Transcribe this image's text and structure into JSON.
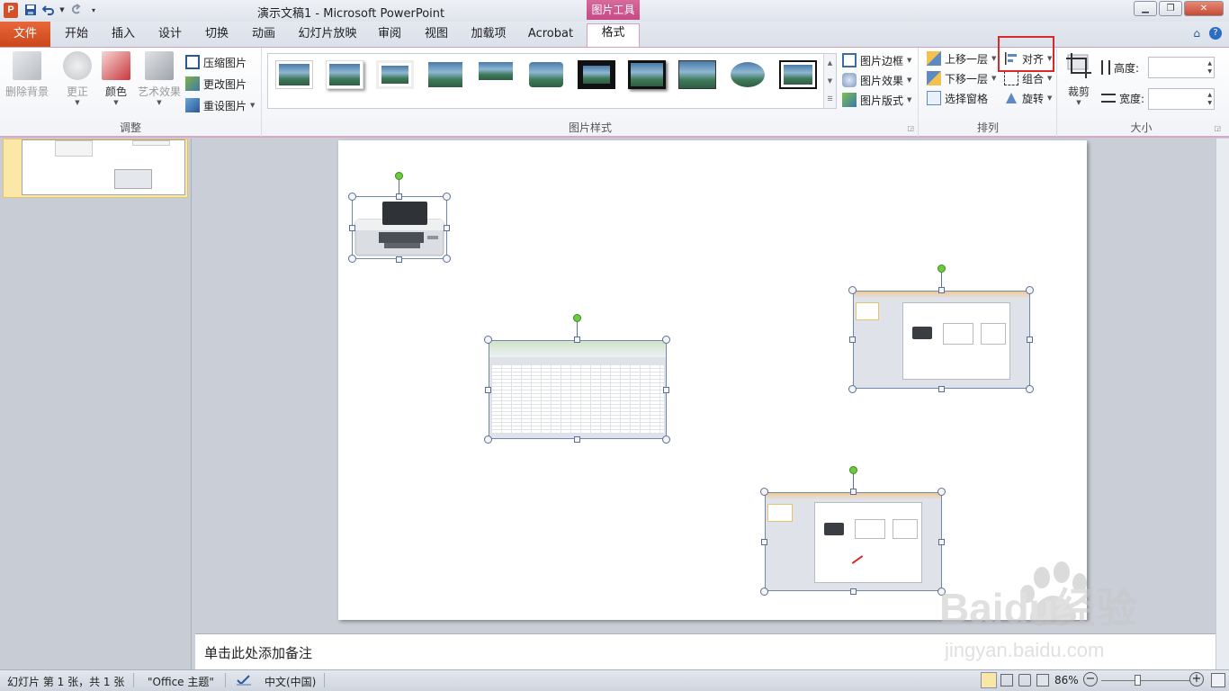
{
  "window": {
    "app_icon": "P",
    "title": "演示文稿1  -  Microsoft PowerPoint",
    "contextual_tab_header": "图片工具"
  },
  "tabs": [
    "文件",
    "开始",
    "插入",
    "设计",
    "切换",
    "动画",
    "幻灯片放映",
    "审阅",
    "视图",
    "加载项",
    "Acrobat",
    "格式"
  ],
  "ribbon": {
    "adjust": {
      "label": "调整",
      "remove_bg": "删除背景",
      "corrections": "更正",
      "color": "颜色",
      "artistic": "艺术效果",
      "compress": "压缩图片",
      "change": "更改图片",
      "reset": "重设图片"
    },
    "styles": {
      "label": "图片样式",
      "border": "图片边框",
      "effects": "图片效果",
      "layout": "图片版式"
    },
    "arrange": {
      "label": "排列",
      "bring_forward": "上移一层",
      "send_backward": "下移一层",
      "selection_pane": "选择窗格",
      "align": "对齐",
      "group": "组合",
      "rotate": "旋转"
    },
    "size": {
      "label": "大小",
      "crop": "裁剪",
      "height_label": "高度:",
      "width_label": "宽度:",
      "height_value": "",
      "width_value": ""
    }
  },
  "notes": {
    "placeholder": "单击此处添加备注"
  },
  "status": {
    "slide_info": "幻灯片 第 1 张，共 1 张",
    "theme": "\"Office 主题\"",
    "language": "中文(中国)",
    "zoom": "86%",
    "zoom_minus": "−",
    "zoom_plus": "+"
  },
  "watermark": {
    "brand": "Baidu经验",
    "url": "jingyan.baidu.com"
  },
  "colors": {
    "file_tab": "#d1511f",
    "contextual": "#c54a86",
    "highlight": "#d9292a",
    "rotation_handle": "#6ccb3c"
  }
}
